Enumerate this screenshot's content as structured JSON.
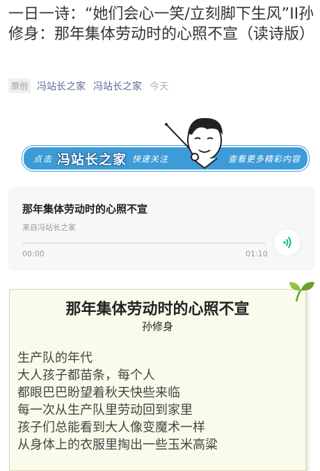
{
  "article": {
    "title": "一日一诗：“她们会心一笑/立刻脚下生风”II孙修身：那年集体劳动时的心照不宣（读诗版）",
    "original_tag": "原创",
    "author": "冯站长之家",
    "account": "冯站长之家",
    "date": "今天"
  },
  "banner": {
    "prefix": "点击",
    "brand": "冯站长之家",
    "follow": "快速关注",
    "more": "查看更多精彩内容"
  },
  "audio": {
    "title": "那年集体劳动时的心照不宣",
    "source": "来自冯站长之家",
    "current_time": "00:00",
    "duration": "01:10",
    "progress": 0
  },
  "poem": {
    "title": "那年集体劳动时的心照不宣",
    "author": "孙修身",
    "lines": [
      "生产队的年代",
      "大人孩子都苗条，每个人",
      "都眼巴巴盼望着秋天快些来临",
      "每一次从生产队里劳动回到家里",
      "孩子们总能看到大人像变魔术一样",
      "从身体上的衣服里掏出一些玉米高粱"
    ]
  },
  "colors": {
    "link": "#576b95",
    "banner_blue": "#3d9bd7",
    "play_green": "#07c160",
    "poem_bg": "#fbfbeb"
  },
  "icons": [
    "audio-play-icon",
    "sprout-icon",
    "avatar-icon"
  ]
}
